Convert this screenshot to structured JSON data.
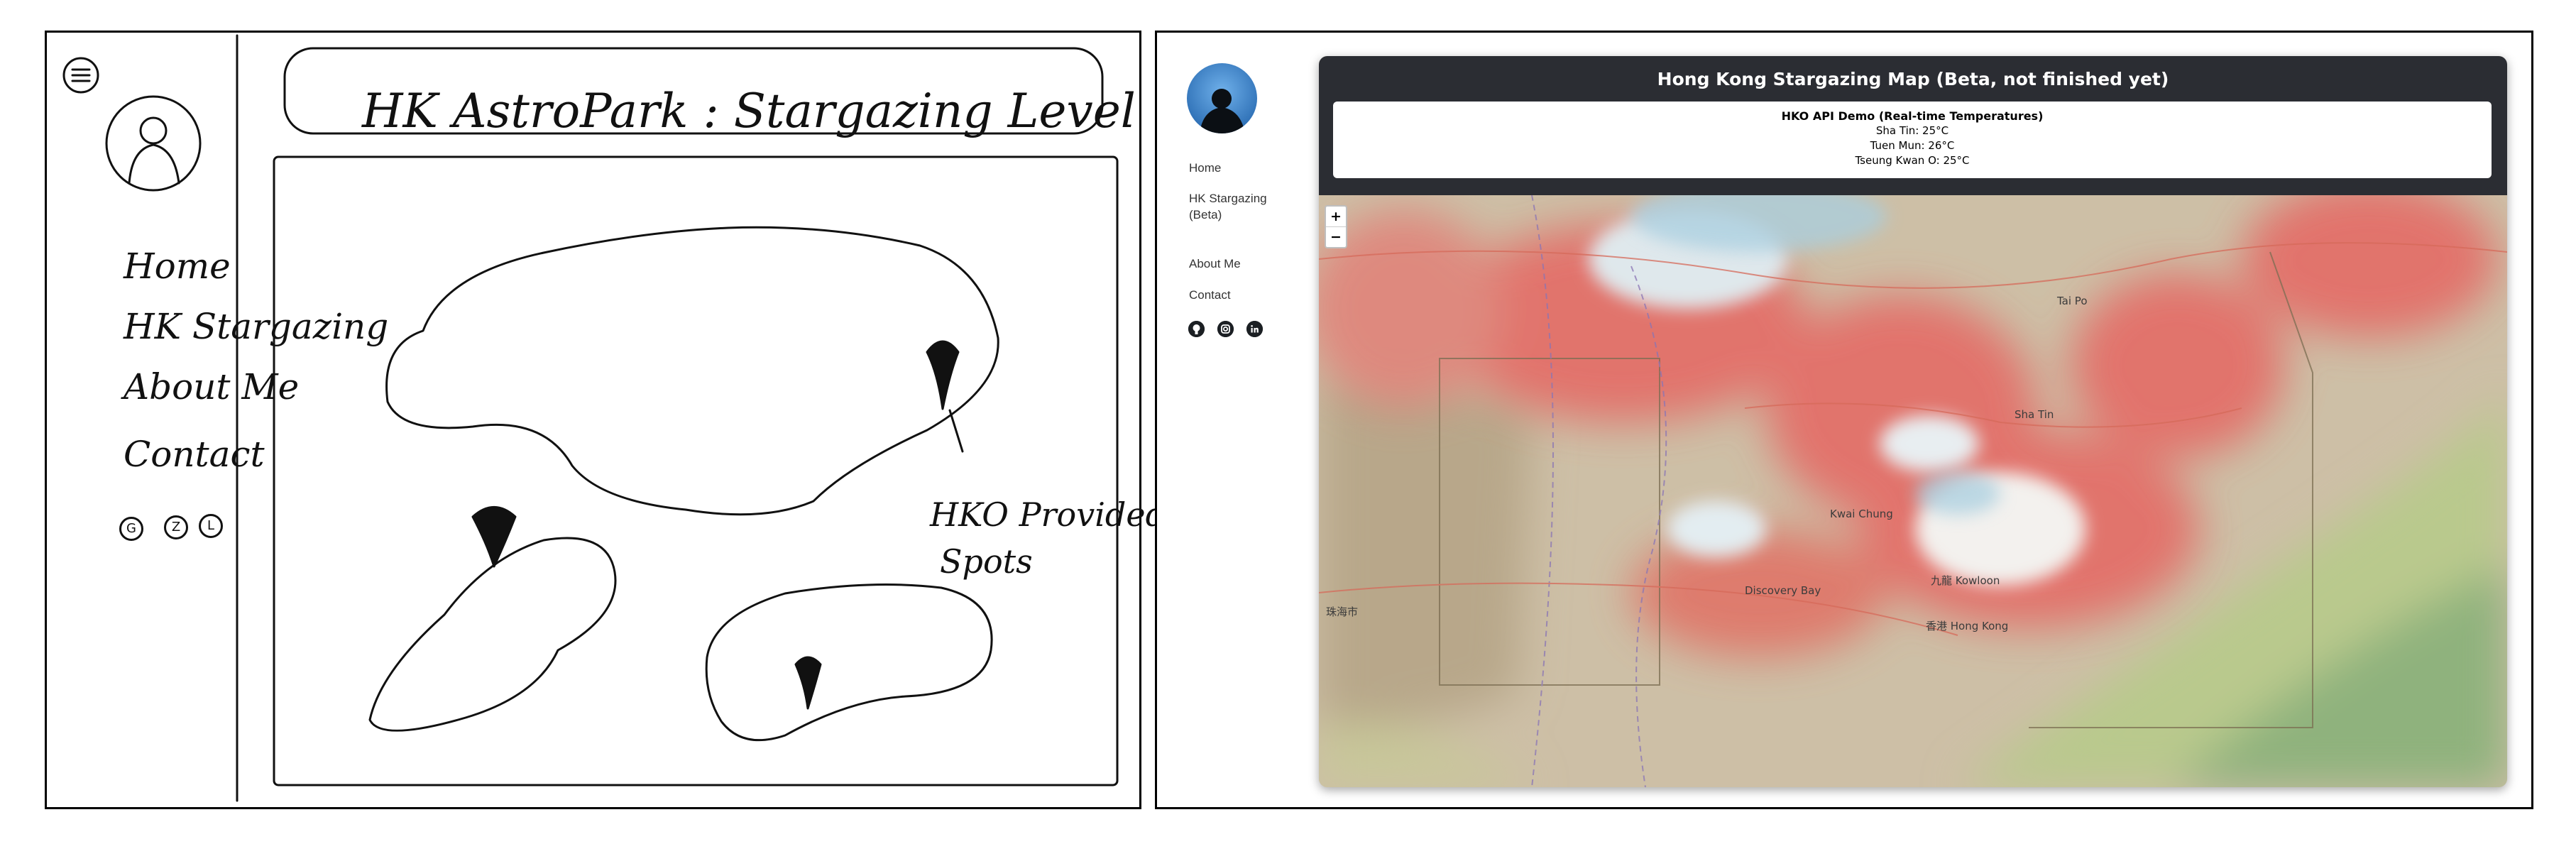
{
  "sketch": {
    "title": "HK AstroPark : Stargazing Level",
    "nav": [
      "Home",
      "HK Stargazing",
      "About Me",
      "Contact"
    ],
    "icon_letters": [
      "G",
      "Z",
      "L"
    ],
    "annotation": [
      "HKO Provided",
      "Spots"
    ]
  },
  "sidebar": {
    "nav": [
      "Home",
      "HK Stargazing (Beta)",
      "About Me",
      "Contact"
    ],
    "social_icons": [
      "github-icon",
      "instagram-icon",
      "linkedin-icon"
    ]
  },
  "map": {
    "title": "Hong Kong Stargazing Map (Beta, not finished yet)",
    "api_box": {
      "title": "HKO API Demo (Real-time Temperatures)",
      "lines": [
        "Sha Tin: 25°C",
        "Tuen Mun: 26°C",
        "Tseung Kwan O: 25°C"
      ]
    },
    "zoom_in": "+",
    "zoom_out": "−",
    "place_labels": [
      "九龍 Kowloon",
      "香港 Hong Kong",
      "Discovery Bay",
      "Kwai Chung",
      "Sha Tin",
      "Tai Po",
      "珠海市"
    ]
  },
  "colors": {
    "header_bg": "#2b2d33",
    "heat_red": "#e8706a",
    "land_green": "#b8c98a",
    "sea_blue": "#a9cfe0"
  }
}
